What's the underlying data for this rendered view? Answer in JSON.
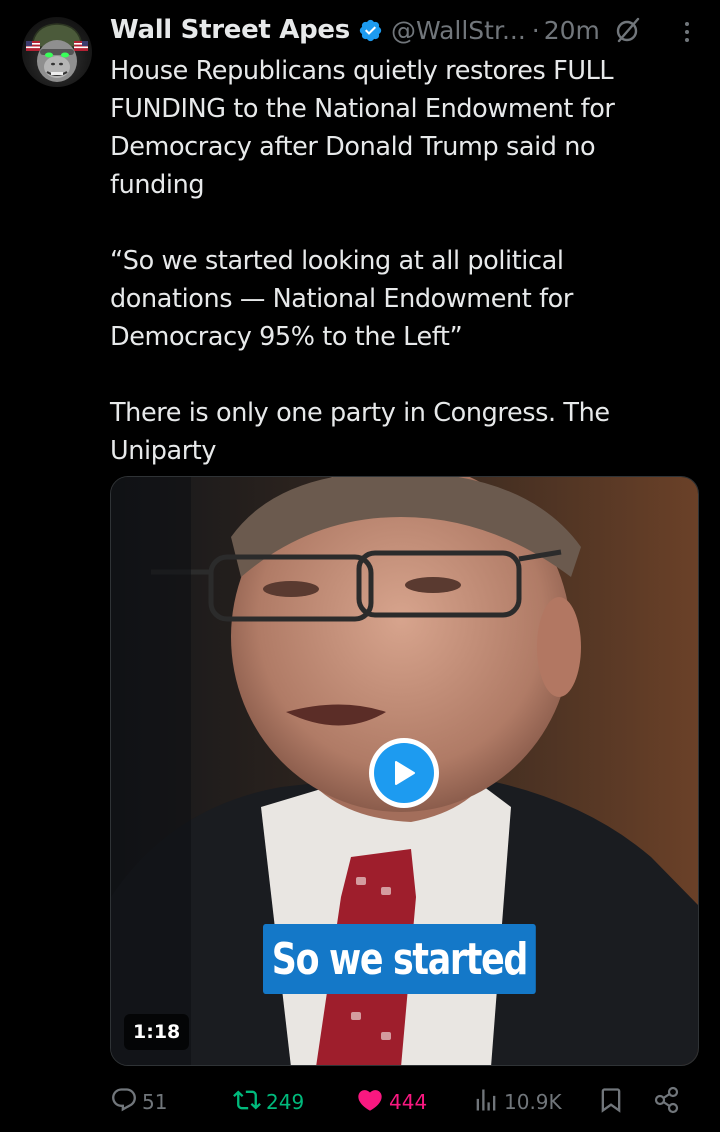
{
  "author": {
    "display_name": "Wall Street Apes",
    "handle": "@WallStr...",
    "separator": "·",
    "time": "20m",
    "verified": true
  },
  "tweet": {
    "paragraphs": [
      "House Republicans quietly restores FULL FUNDING to the National Endowment for Democracy after Donald Trump said no funding",
      "“So we started looking at all political donations — National Endowment for Democracy 95% to the Left”",
      "There is only one party in Congress. The Uniparty"
    ]
  },
  "media": {
    "type": "video",
    "caption": "So we started",
    "duration": "1:18"
  },
  "actions": {
    "reply_count": "51",
    "retweet_count": "249",
    "like_count": "444",
    "view_count": "10.9K"
  },
  "icons": {
    "verified": "verified-badge-icon",
    "grok": "grok-icon",
    "more": "more-icon",
    "reply": "reply-icon",
    "retweet": "retweet-icon",
    "like": "heart-icon",
    "views": "views-icon",
    "bookmark": "bookmark-icon",
    "share": "share-icon",
    "play": "play-icon"
  },
  "colors": {
    "background": "#000000",
    "text": "#e7e9ea",
    "muted": "#71767b",
    "accent": "#1d9bf0",
    "retweet_active": "#00ba7c",
    "like_active": "#f91880",
    "caption_bg": "#1478c8"
  }
}
